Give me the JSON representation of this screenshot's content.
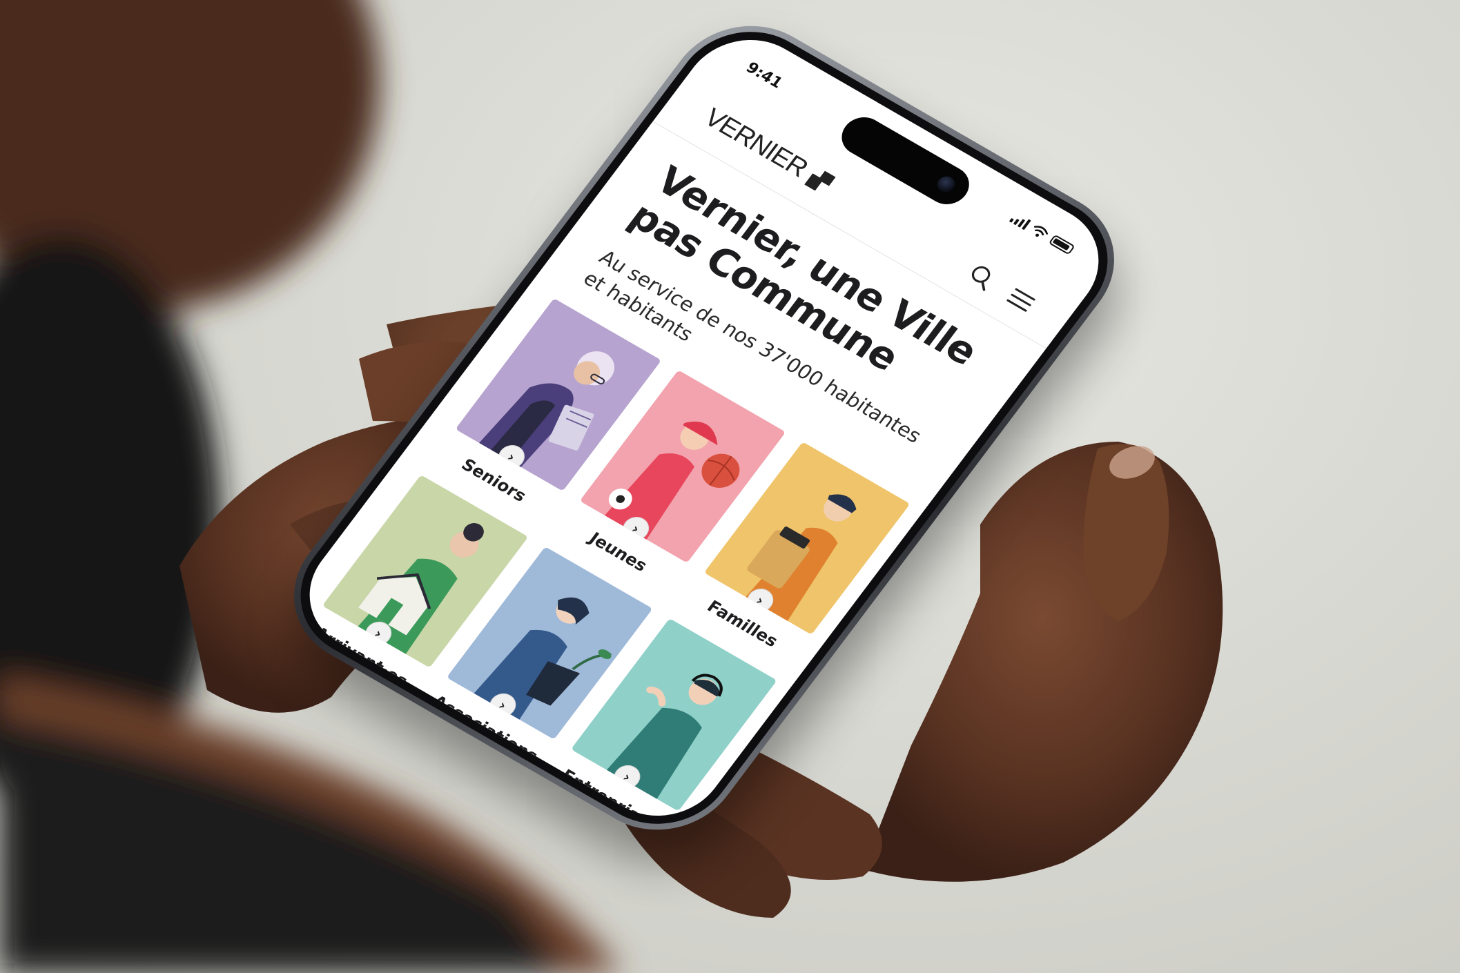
{
  "status_bar": {
    "time": "9:41"
  },
  "header": {
    "logo_text": "VERNIER"
  },
  "hero": {
    "title": "Vernier, une Ville pas Commune",
    "subtitle": "Au service de nos 37'000 habitantes et habitants"
  },
  "cards": [
    {
      "label": "Seniors",
      "color": "#b7a3cf"
    },
    {
      "label": "Jeunes",
      "color": "#f2a3ad"
    },
    {
      "label": "Familles",
      "color": "#f0c46a"
    },
    {
      "label": "Arrivant·es",
      "color": "#c9d6a8"
    },
    {
      "label": "Associations",
      "color": "#9fb9d8"
    },
    {
      "label": "Entreprises",
      "color": "#8fd0c9"
    }
  ],
  "icons": [
    "search-icon",
    "menu-icon",
    "chevron-right-icon",
    "wifi-icon",
    "battery-icon",
    "signal-icon"
  ]
}
